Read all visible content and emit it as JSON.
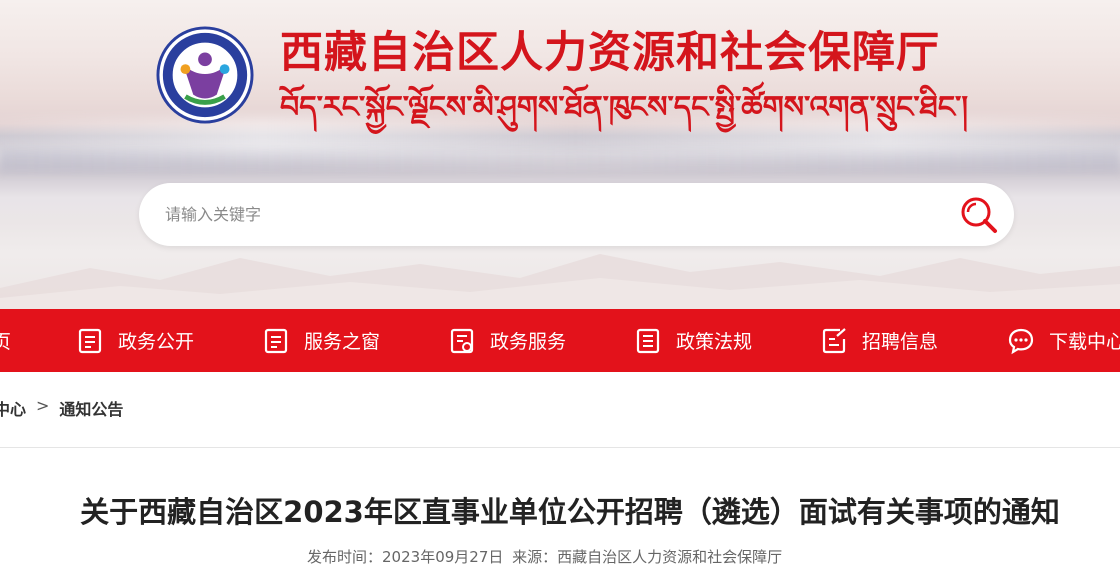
{
  "header": {
    "title": "西藏自治区人力资源和社会保障厅",
    "subtitle_tibetan": "བོད་རང་སྐྱོང་ལྗོངས་མི་ཤུགས་ཐོན་ཁུངས་དང་སྤྱི་ཚོགས་འགན་སྲུང་ཐིང་།",
    "logo_icon": "people-emblem-icon",
    "colors": {
      "brand_red": "#d4151c",
      "nav_red": "#e3121b",
      "logo_blue": "#2a3f9e",
      "logo_purple": "#7b3fa0",
      "logo_green": "#3aa04a"
    }
  },
  "search": {
    "placeholder": "请输入关键字",
    "value": "",
    "icon": "search-icon"
  },
  "nav": {
    "items": [
      {
        "label": "页",
        "icon": ""
      },
      {
        "label": "政务公开",
        "icon": "document-icon"
      },
      {
        "label": "服务之窗",
        "icon": "document-icon"
      },
      {
        "label": "政务服务",
        "icon": "checklist-icon"
      },
      {
        "label": "政策法规",
        "icon": "document-list-icon"
      },
      {
        "label": "招聘信息",
        "icon": "edit-document-icon"
      },
      {
        "label": "下载中心",
        "icon": "chat-icon"
      }
    ]
  },
  "breadcrumb": {
    "items": [
      "中心",
      "通知公告"
    ],
    "separator": ">"
  },
  "article": {
    "title": "关于西藏自治区2023年区直事业单位公开招聘（遴选）面试有关事项的通知",
    "publish_label": "发布时间：",
    "publish_date": "2023年09月27日",
    "source_label": "来源：",
    "source": "西藏自治区人力资源和社会保障厅"
  }
}
